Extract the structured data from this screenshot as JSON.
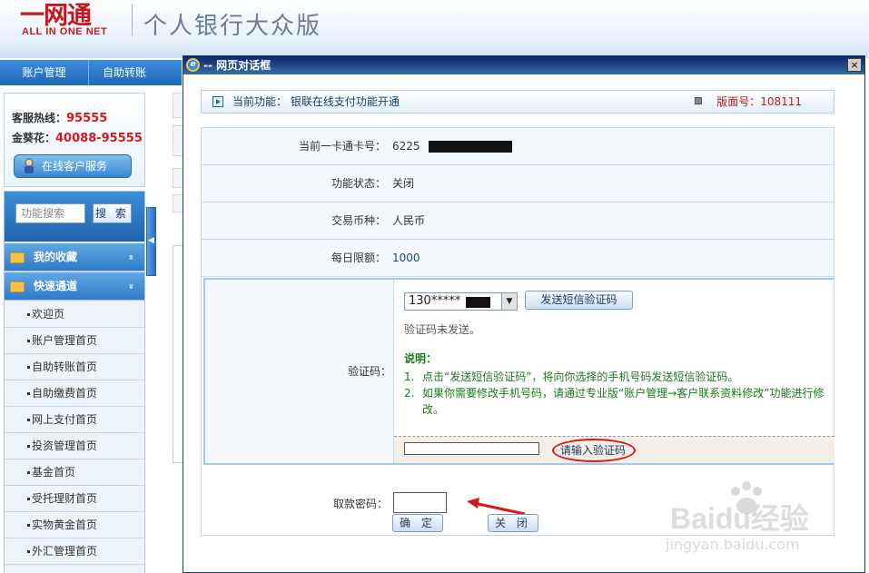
{
  "banner": {
    "logo_main": "一网通",
    "logo_sub": "ALL IN ONE NET",
    "title": "个人银行大众版"
  },
  "topnav": {
    "items": [
      "账户管理",
      "自助转账"
    ]
  },
  "hotline": {
    "rows": [
      {
        "label": "客服热线：",
        "value": "95555"
      },
      {
        "label": "金葵花：",
        "value": "40088-95555"
      }
    ],
    "service_button": "在线客户服务"
  },
  "search": {
    "placeholder": "功能搜索",
    "button": "搜 索"
  },
  "menu": {
    "groups": [
      {
        "label": "我的收藏",
        "chevron": "«"
      },
      {
        "label": "快速通道",
        "chevron": "»"
      }
    ],
    "items": [
      "欢迎页",
      "账户管理首页",
      "自助转账首页",
      "自助缴费首页",
      "网上支付首页",
      "投资管理首页",
      "基金首页",
      "受托理财首页",
      "实物黄金首页",
      "外汇管理首页"
    ]
  },
  "dialog": {
    "title": "-- 网页对话框",
    "close": "×",
    "func_label": "当前功能： 银联在线支付功能开通",
    "page_no": "版面号：108111",
    "fields": [
      {
        "label": "当前一卡通卡号：",
        "value": "6225"
      },
      {
        "label": "功能状态：",
        "value": "关闭"
      },
      {
        "label": "交易币种：",
        "value": "人民币"
      },
      {
        "label": "每日限额：",
        "value": "1000"
      }
    ],
    "verify": {
      "label": "验证码：",
      "phone": "130*****",
      "sms_button": "发送短信验证码",
      "status": "验证码未发送。",
      "explain_head": "说明：",
      "explain": [
        {
          "n": "1.",
          "t": "点击“发送短信验证码”，将向你选择的手机号码发送短信验证码。"
        },
        {
          "n": "2.",
          "t": "如果你需要修改手机号码，请通过专业版“账户管理→客户联系资料修改”功能进行修改。"
        }
      ],
      "code_hint": "请输入验证码"
    },
    "password_label": "取款密码：",
    "confirm": "确 定",
    "close_btn": "关 闭"
  },
  "watermark": {
    "main": "Baidu经验",
    "sub": "jingyan.baidu.com"
  }
}
